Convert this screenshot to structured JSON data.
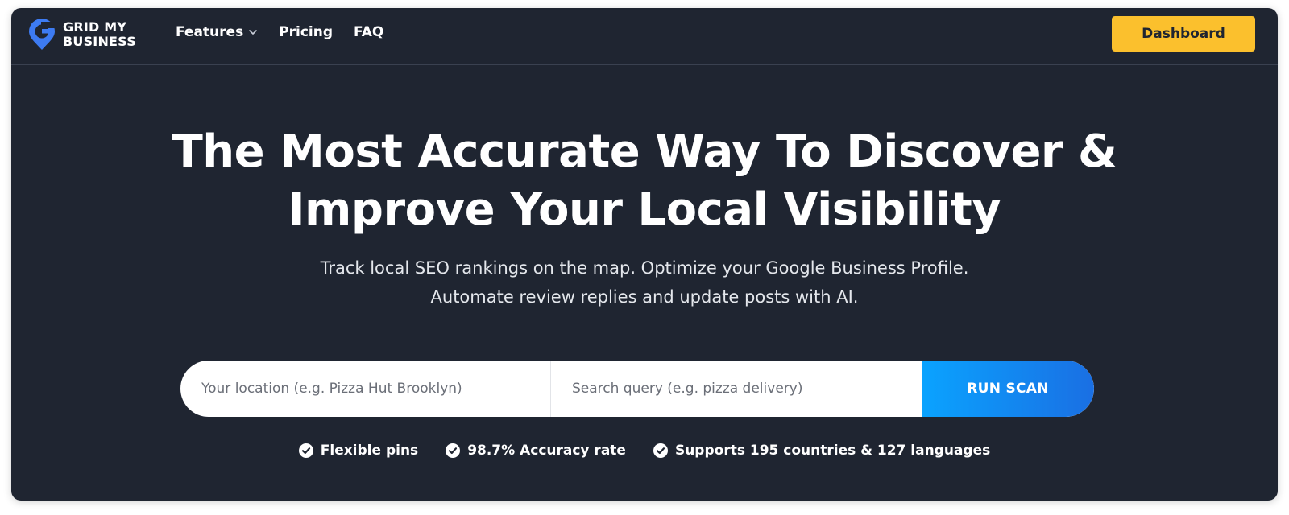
{
  "brand": {
    "line1": "GRID MY",
    "line2": "BUSINESS",
    "logo_icon": "google-g-pin-icon",
    "logo_color": "#3d7bf2"
  },
  "nav": {
    "items": [
      {
        "label": "Features",
        "has_dropdown": true
      },
      {
        "label": "Pricing"
      },
      {
        "label": "FAQ"
      }
    ],
    "dashboard_label": "Dashboard"
  },
  "hero": {
    "title_line1": "The Most Accurate Way To Discover &",
    "title_line2": "Improve Your Local Visibility",
    "subtitle_line1": "Track local SEO rankings on the map. Optimize your Google Business Profile.",
    "subtitle_line2": "Automate review replies and update posts with AI."
  },
  "search": {
    "location_placeholder": "Your location (e.g. Pizza Hut Brooklyn)",
    "query_placeholder": "Search query (e.g. pizza delivery)",
    "button_label": "RUN SCAN"
  },
  "features": [
    {
      "icon": "check-circle-icon",
      "label": "Flexible pins"
    },
    {
      "icon": "check-circle-icon",
      "label": "98.7% Accuracy rate"
    },
    {
      "icon": "check-circle-icon",
      "label": "Supports 195 countries & 127 languages"
    }
  ],
  "colors": {
    "background": "#1f2531",
    "accent_yellow": "#fbc02d",
    "accent_blue_start": "#0aa3ff",
    "accent_blue_end": "#1a6fe3"
  }
}
